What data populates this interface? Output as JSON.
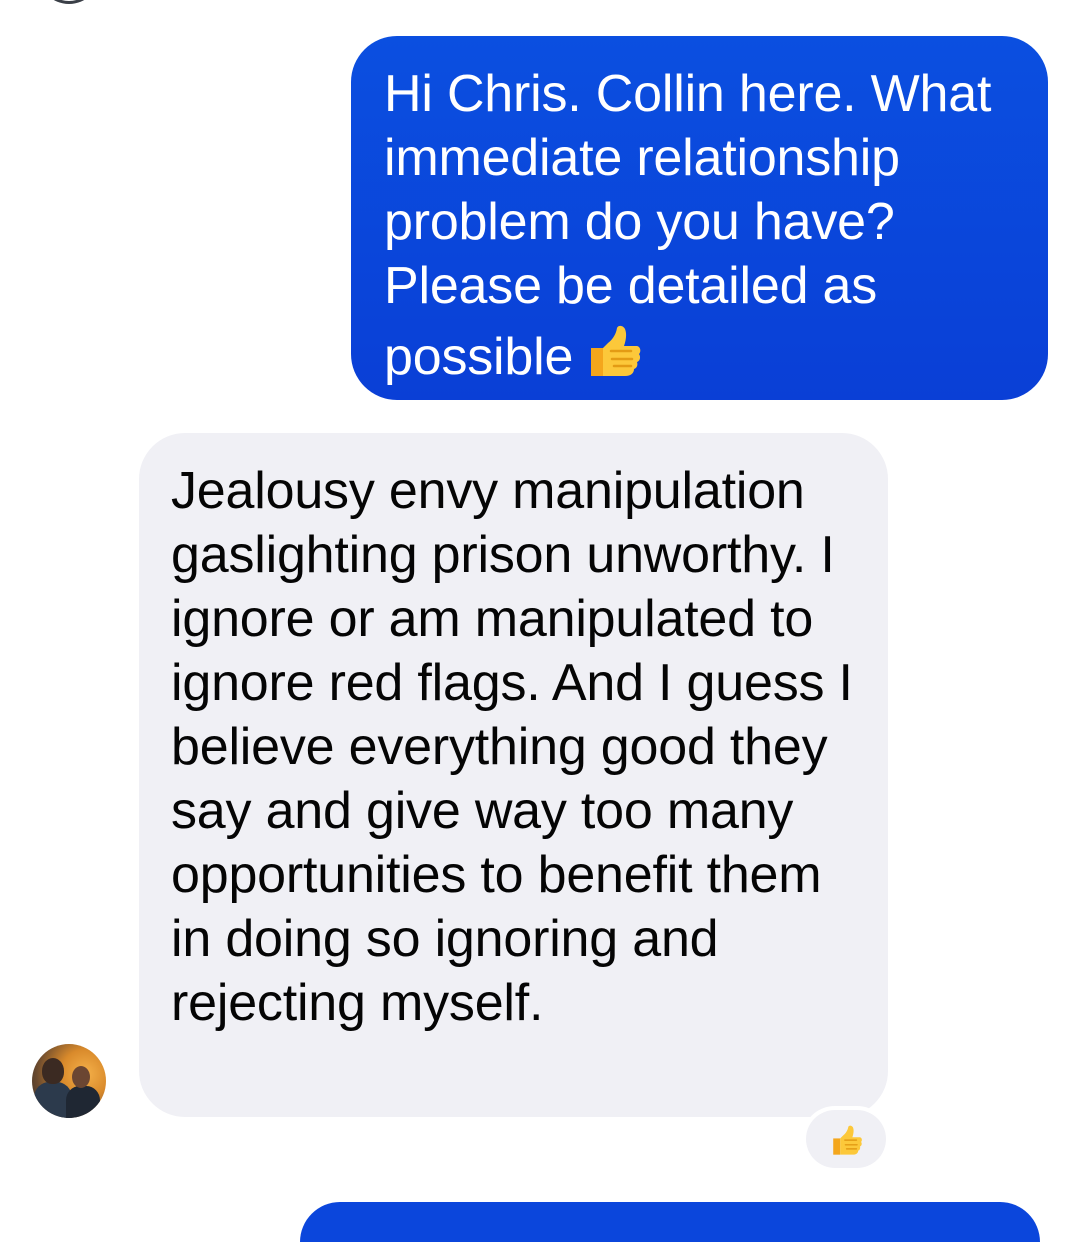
{
  "conversation": {
    "messages": [
      {
        "direction": "outgoing",
        "text": "Hi Chris. Collin here. What immediate relationship problem do you have? Please be detailed as possible",
        "emoji": "thumbs-up-icon",
        "color": "#0a45dc"
      },
      {
        "direction": "incoming",
        "text": "Jealousy envy manipulation gaslighting prison unworthy. I ignore or am manipulated to ignore red flags. And I guess I believe everything good they say and give way too many opportunities to benefit them in doing so ignoring and rejecting myself.",
        "reaction": "thumbs-up-icon",
        "color": "#f0f0f5"
      }
    ]
  },
  "colors": {
    "outgoing_bubble": "#0a45dc",
    "incoming_bubble": "#f0f0f5",
    "emoji_yellow": "#f7b928"
  }
}
